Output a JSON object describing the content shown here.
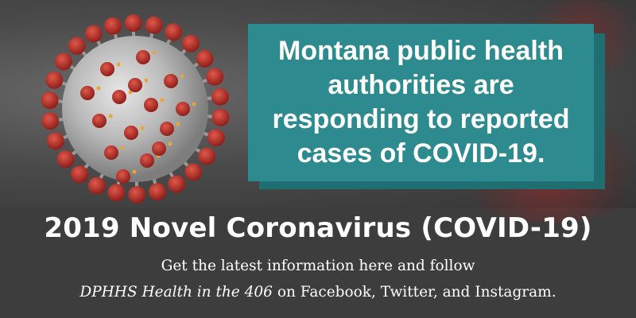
{
  "card": {
    "text": "Montana public health authorities are responding to reported cases of COVID-19."
  },
  "headline": "2019 Novel Coronavirus (COVID-19)",
  "info": {
    "line1": "Get the latest information here and follow",
    "handle": "DPHHS Health in the 406",
    "line2_rest": " on Facebook, Twitter, and Instagram."
  },
  "colors": {
    "background": "#3d3d3d",
    "card": "#2d8a8f",
    "card_shadow": "#1f6f72",
    "virus_spike": "#c0392b",
    "text": "#ffffff"
  },
  "icons": {
    "virus_image": "coronavirus-icon"
  }
}
